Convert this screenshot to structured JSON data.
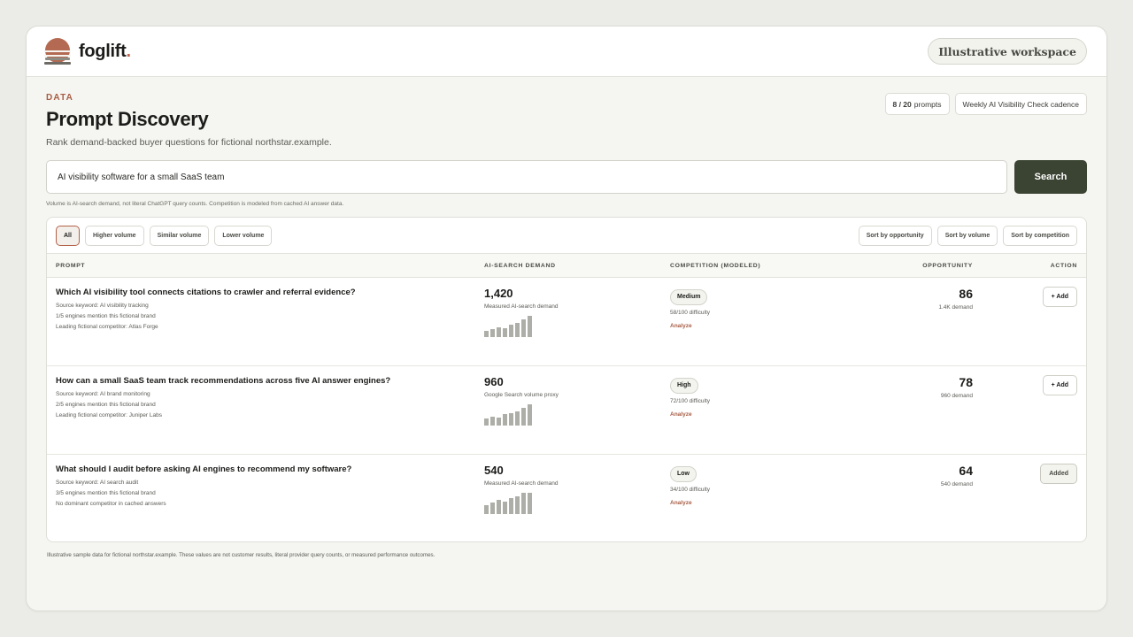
{
  "brand": {
    "name": "foglift",
    "dot": "."
  },
  "header": {
    "workspace": "Illustrative workspace"
  },
  "page": {
    "eyebrow": "DATA",
    "title": "Prompt Discovery",
    "subtitle": "Rank demand-backed buyer questions for fictional northstar.example.",
    "prompt_count": "8 / 20",
    "prompt_count_label": "prompts",
    "cadence": "Weekly AI Visibility Check cadence"
  },
  "search": {
    "value": "AI visibility software for a small SaaS team",
    "button": "Search",
    "note": "Volume is AI-search demand, not literal ChatGPT query counts. Competition is modeled from cached AI answer data."
  },
  "filters": [
    "All",
    "Higher volume",
    "Similar volume",
    "Lower volume"
  ],
  "sorts": [
    "Sort by opportunity",
    "Sort by volume",
    "Sort by competition"
  ],
  "columns": [
    "PROMPT",
    "AI-SEARCH DEMAND",
    "COMPETITION (MODELED)",
    "OPPORTUNITY",
    "ACTION"
  ],
  "rows": [
    {
      "question": "Which AI visibility tool connects citations to crawler and referral evidence?",
      "keyword": "Source keyword: AI visibility tracking",
      "mentions": "1/5 engines mention this fictional brand",
      "competitor": "Leading fictional competitor: Atlas Forge",
      "volume": "1,420",
      "volume_source": "Measured AI-search demand",
      "trend": [
        7,
        9,
        11,
        10,
        14,
        16,
        20,
        24
      ],
      "competition": "Medium",
      "difficulty": "58/100 difficulty",
      "analyze": "Analyze",
      "opportunity": "86",
      "opportunity_sub": "1.4K demand",
      "action": "+ Add"
    },
    {
      "question": "How can a small SaaS team track recommendations across five AI answer engines?",
      "keyword": "Source keyword: AI brand monitoring",
      "mentions": "2/5 engines mention this fictional brand",
      "competitor": "Leading fictional competitor: Juniper Labs",
      "volume": "960",
      "volume_source": "Google Search volume proxy",
      "trend": [
        7,
        9,
        8,
        12,
        13,
        15,
        18,
        22
      ],
      "competition": "High",
      "difficulty": "72/100 difficulty",
      "analyze": "Analyze",
      "opportunity": "78",
      "opportunity_sub": "960 demand",
      "action": "+ Add"
    },
    {
      "question": "What should I audit before asking AI engines to recommend my software?",
      "keyword": "Source keyword: AI search audit",
      "mentions": "3/5 engines mention this fictional brand",
      "competitor": "No dominant competitor in cached answers",
      "volume": "540",
      "volume_source": "Measured AI-search demand",
      "trend": [
        8,
        11,
        13,
        12,
        15,
        17,
        20,
        20
      ],
      "competition": "Low",
      "difficulty": "34/100 difficulty",
      "analyze": "Analyze",
      "opportunity": "64",
      "opportunity_sub": "540 demand",
      "action": "Added"
    }
  ],
  "footer": "Illustrative sample data for fictional northstar.example. These values are not customer results, literal provider query counts, or measured performance outcomes."
}
